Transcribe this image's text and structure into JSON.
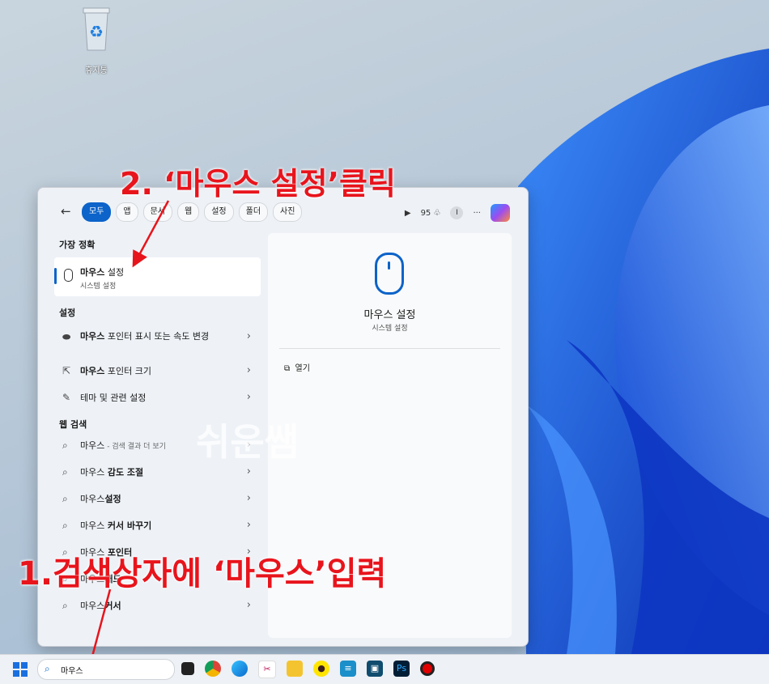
{
  "desktop": {
    "recycle_bin_label": "휴지통",
    "watermark": "쉬운쌤"
  },
  "annotations": {
    "step2": "2. ‘마우스 설정’클릭",
    "step1": "1.검색상자에 ‘마우스’입력"
  },
  "search_panel": {
    "filters": [
      "모두",
      "앱",
      "문서",
      "웹",
      "설정",
      "폴더",
      "사진"
    ],
    "points": "95",
    "avatar": "I",
    "more": "···",
    "best_match": {
      "section": "가장 정확",
      "title_bold": "마우스",
      "title_rest": " 설정",
      "subtitle": "시스템 설정"
    },
    "settings": {
      "section": "설정",
      "items": [
        {
          "bold": "마우스",
          "rest": " 포인터 표시 또는 속도 변경"
        },
        {
          "bold": "마우스",
          "rest": " 포인터 크기"
        },
        {
          "bold": "",
          "rest": "테마 및 관련 설정"
        }
      ]
    },
    "web": {
      "section": "웹 검색",
      "items": [
        {
          "pre": "마우스",
          "bold": "",
          "post": " - 검색 결과 더 보기"
        },
        {
          "pre": "마우스 ",
          "bold": "감도 조절",
          "post": ""
        },
        {
          "pre": "마우스",
          "bold": "설정",
          "post": ""
        },
        {
          "pre": "마우스 ",
          "bold": "커서 바꾸기",
          "post": ""
        },
        {
          "pre": "마우스 ",
          "bold": "포인터",
          "post": ""
        },
        {
          "pre": "마우스",
          "bold": "패드",
          "post": ""
        },
        {
          "pre": "마우스",
          "bold": "커서",
          "post": ""
        }
      ]
    },
    "detail": {
      "title": "마우스 설정",
      "subtitle": "시스템 설정",
      "open_label": "열기"
    }
  },
  "taskbar": {
    "search_value": "마우스"
  }
}
